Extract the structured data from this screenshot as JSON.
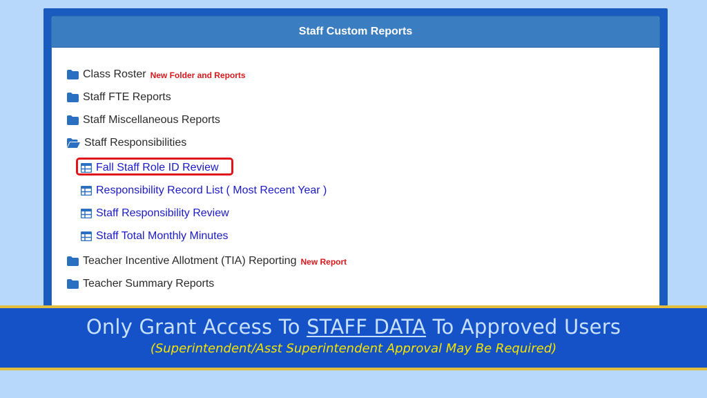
{
  "panel": {
    "title": "Staff Custom Reports"
  },
  "tree": {
    "folders": {
      "class_roster": {
        "label": "Class Roster",
        "tag": "New Folder and Reports"
      },
      "staff_fte": {
        "label": "Staff FTE Reports"
      },
      "staff_misc": {
        "label": "Staff Miscellaneous Reports"
      },
      "staff_resp": {
        "label": "Staff Responsibilities",
        "expanded": true
      },
      "tia": {
        "label": "Teacher Incentive Allotment (TIA) Reporting",
        "tag": "New Report"
      },
      "teacher_summary": {
        "label": "Teacher Summary Reports"
      }
    },
    "reports": [
      {
        "label": "Fall Staff Role ID Review",
        "highlighted": true
      },
      {
        "label": "Responsibility Record List ( Most Recent Year )"
      },
      {
        "label": "Staff Responsibility Review"
      },
      {
        "label": "Staff Total Monthly Minutes"
      }
    ]
  },
  "banner": {
    "line1_pre": "Only Grant Access To ",
    "line1_em": "STAFF DATA",
    "line1_post": " To Approved Users",
    "line2": "(Superintendent/Asst Superintendent Approval May Be Required)"
  },
  "colors": {
    "page_bg": "#b7d7fb",
    "header_bg": "#3a7dc0",
    "link": "#1a1ac6",
    "tag_red": "#d7191c",
    "highlight": "#e0141a",
    "banner_bg": "#1551c7",
    "banner_border": "#e3be3c",
    "banner_text": "#c6e0ff",
    "banner_note": "#f4e400"
  },
  "icons": {
    "folder": "folder-icon",
    "folder_open": "folder-open-icon",
    "report": "table-icon"
  }
}
